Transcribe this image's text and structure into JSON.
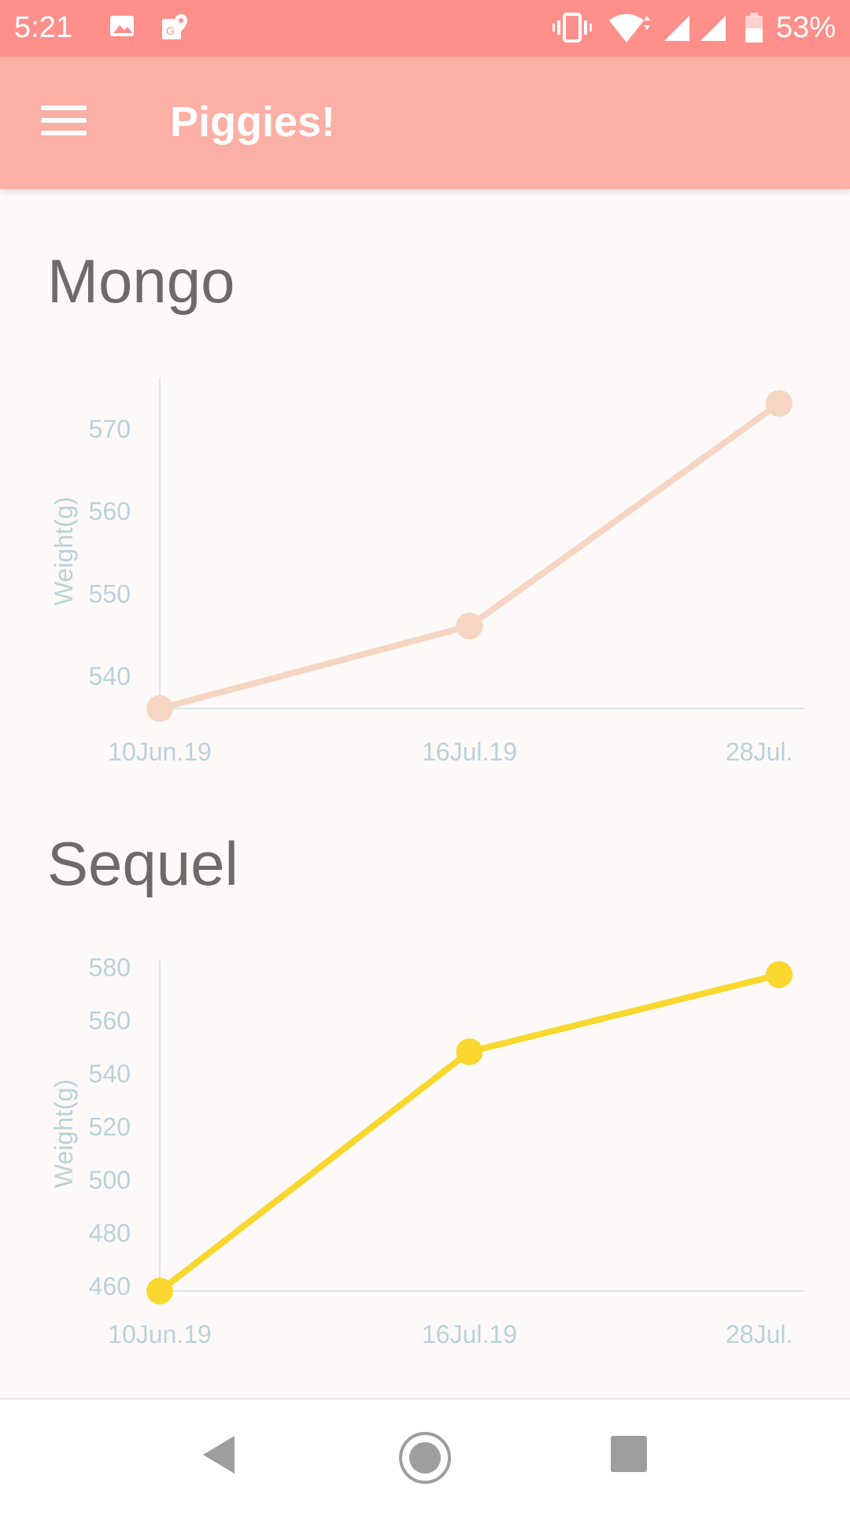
{
  "status_bar": {
    "time": "5:21",
    "battery": "53%",
    "icons": [
      "image-icon",
      "maps-icon",
      "vibrate-icon",
      "wifi-icon",
      "signal-icon",
      "signal-icon",
      "battery-icon"
    ]
  },
  "app_bar": {
    "title": "Piggies!",
    "menu_icon": "menu-icon"
  },
  "colors": {
    "status_bar": "#ff8f8b",
    "app_bar": "#fbafa5",
    "mongo_line": "#f6d6c2",
    "sequel_line": "#fad72e",
    "axis_text": "#b9d2da"
  },
  "pigs": [
    {
      "name": "Mongo"
    },
    {
      "name": "Sequel"
    }
  ],
  "chart_data": [
    {
      "type": "line",
      "title": "Mongo",
      "ylabel": "Weight(g)",
      "xlabel": "",
      "categories": [
        "10Jun.19",
        "16Jul.19",
        "28Jul."
      ],
      "series": [
        {
          "values": [
            536,
            546,
            573
          ]
        }
      ],
      "yticks": [
        540,
        550,
        560,
        570
      ],
      "ylim": [
        536,
        574
      ],
      "grid": false,
      "color": "#f6d6c2"
    },
    {
      "type": "line",
      "title": "Sequel",
      "ylabel": "Weight(g)",
      "xlabel": "",
      "categories": [
        "10Jun.19",
        "16Jul.19",
        "28Jul."
      ],
      "series": [
        {
          "values": [
            458,
            548,
            577
          ]
        }
      ],
      "yticks": [
        460,
        480,
        500,
        520,
        540,
        560,
        580
      ],
      "ylim": [
        458,
        580
      ],
      "grid": false,
      "color": "#fad72e"
    }
  ],
  "nav_bar": {
    "back_icon": "back-icon",
    "home_icon": "home-icon",
    "recents_icon": "recents-icon"
  }
}
